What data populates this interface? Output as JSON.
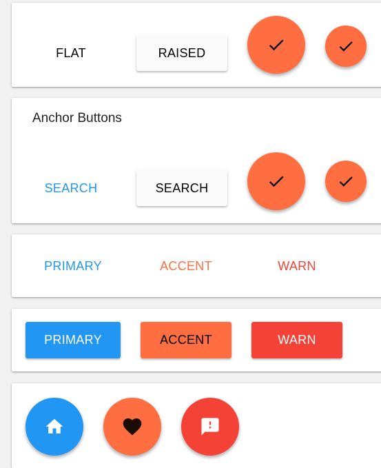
{
  "colors": {
    "primary": "#2196f3",
    "accent": "#ff6e40",
    "warn": "#f44336",
    "raised_bg": "#fafafa",
    "text_dark": "#000000"
  },
  "section_basic": {
    "flat_label": "FLAT",
    "raised_label": "RAISED",
    "fab_icon": "check-icon",
    "mini_fab_icon": "check-icon"
  },
  "section_anchor": {
    "title": "Anchor Buttons",
    "flat_label": "SEARCH",
    "raised_label": "SEARCH",
    "fab_icon": "check-icon",
    "mini_fab_icon": "check-icon"
  },
  "section_flat_colors": {
    "primary_label": "PRIMARY",
    "accent_label": "ACCENT",
    "warn_label": "WARN"
  },
  "section_raised_colors": {
    "primary_label": "PRIMARY",
    "accent_label": "ACCENT",
    "warn_label": "WARN"
  },
  "section_fab_colors": {
    "primary_icon": "home-icon",
    "accent_icon": "heart-icon",
    "warn_icon": "feedback-icon"
  }
}
